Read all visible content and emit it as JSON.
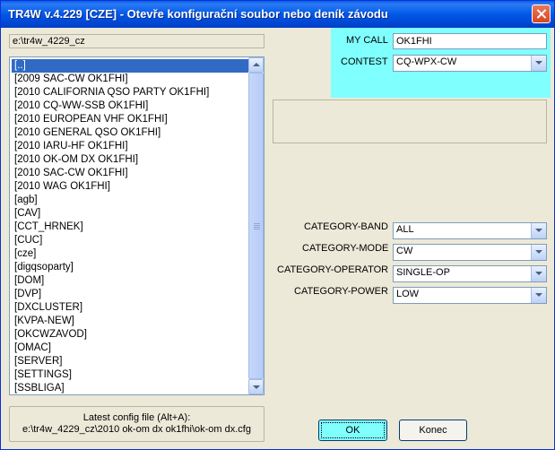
{
  "window": {
    "title": "TR4W v.4.229 [CZE] - Otevře konfigurační soubor nebo deník závodu"
  },
  "path_field": {
    "value": "e:\\tr4w_4229_cz"
  },
  "list": {
    "selected_index": 0,
    "items": [
      "[..]",
      "[2009 SAC-CW OK1FHI]",
      "[2010 CALIFORNIA QSO PARTY OK1FHI]",
      "[2010 CQ-WW-SSB OK1FHI]",
      "[2010 EUROPEAN VHF OK1FHI]",
      "[2010 GENERAL QSO OK1FHI]",
      "[2010 IARU-HF OK1FHI]",
      "[2010 OK-OM DX OK1FHI]",
      "[2010 SAC-CW OK1FHI]",
      "[2010 WAG OK1FHI]",
      "[agb]",
      "[CAV]",
      "[CCT_HRNEK]",
      "[CUC]",
      "[cze]",
      "[digqsoparty]",
      "[DOM]",
      "[DVP]",
      "[DXCLUSTER]",
      "[KVPA-NEW]",
      "[OKCWZAVOD]",
      "[OMAC]",
      "[SERVER]",
      "[SETTINGS]",
      "[SSBLIGA]"
    ]
  },
  "latest_config": {
    "label": "Latest config file (Alt+A):",
    "path": "e:\\tr4w_4229_cz\\2010 ok-om dx ok1fhi\\ok-om dx.cfg"
  },
  "my_call": {
    "label": "MY CALL",
    "value": "OK1FHI"
  },
  "contest": {
    "label": "CONTEST",
    "value": "CQ-WPX-CW"
  },
  "category": {
    "band": {
      "label": "CATEGORY-BAND",
      "value": "ALL"
    },
    "mode": {
      "label": "CATEGORY-MODE",
      "value": "CW"
    },
    "operator": {
      "label": "CATEGORY-OPERATOR",
      "value": "SINGLE-OP"
    },
    "power": {
      "label": "CATEGORY-POWER",
      "value": "LOW"
    }
  },
  "buttons": {
    "ok": "OK",
    "konec": "Konec"
  },
  "colors": {
    "accent_cyan": "#80ffff",
    "title_blue": "#0058e6",
    "selection": "#316ac5"
  }
}
